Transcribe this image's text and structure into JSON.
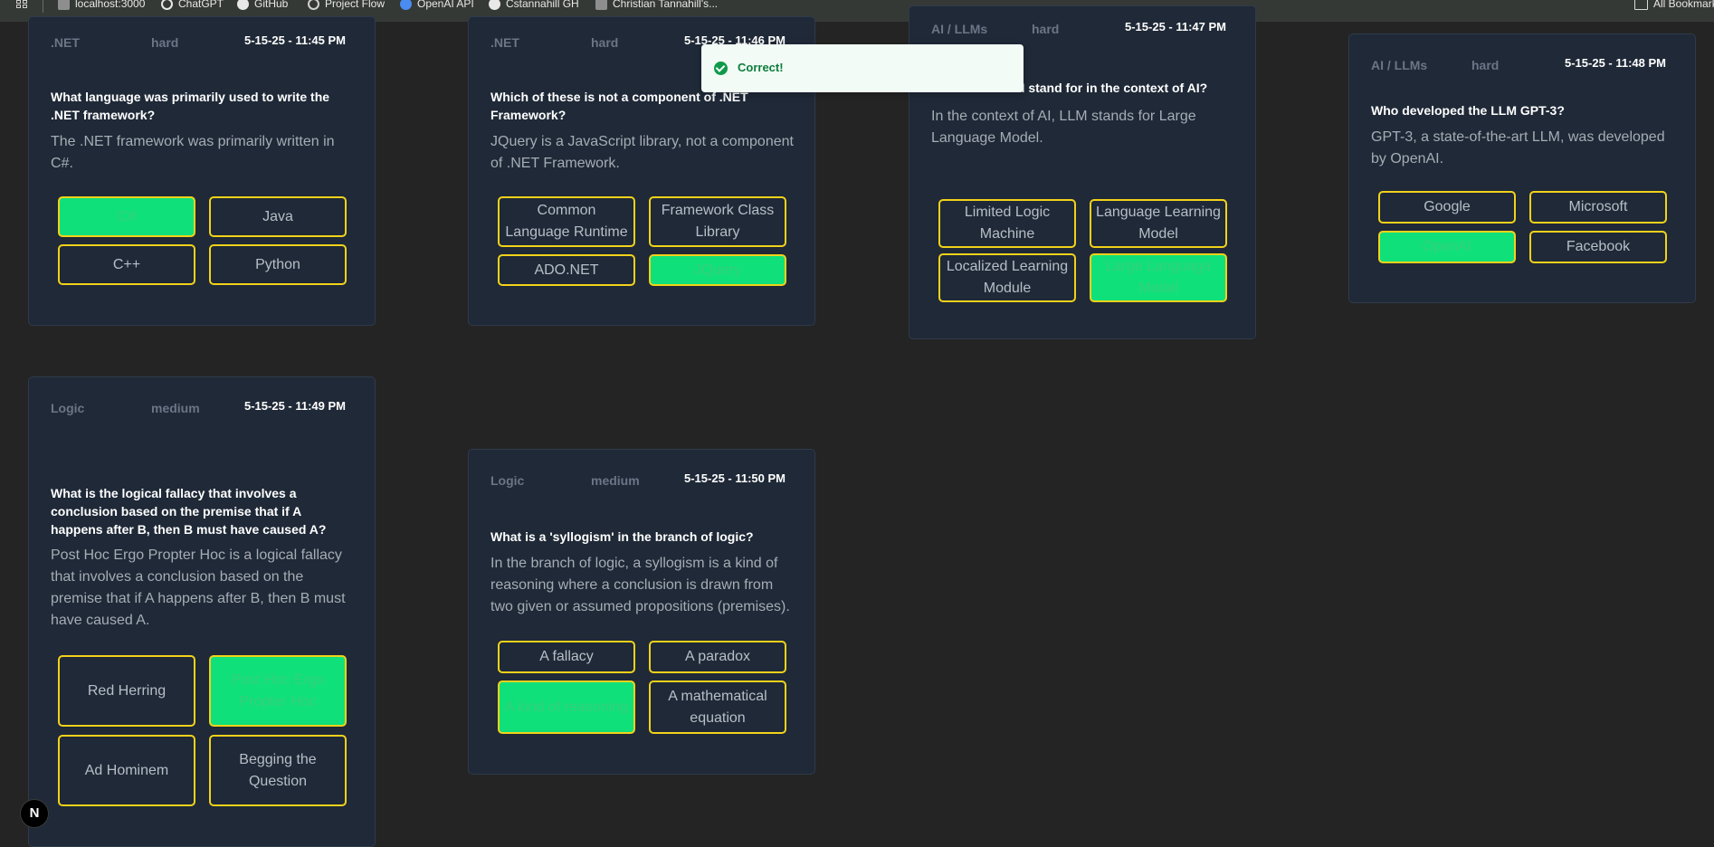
{
  "bookmarks": {
    "items": [
      {
        "label": "localhost:3000",
        "icon": "page-icon"
      },
      {
        "label": "ChatGPT",
        "icon": "chatgpt-icon"
      },
      {
        "label": "GitHub",
        "icon": "github-icon"
      },
      {
        "label": "Project Flow",
        "icon": "globe-icon"
      },
      {
        "label": "OpenAI API",
        "icon": "openai-icon"
      },
      {
        "label": "Cstannahill GH",
        "icon": "github-icon"
      },
      {
        "label": "Christian Tannahill's...",
        "icon": "page-icon"
      }
    ],
    "all_bookmarks": "All Bookmarks"
  },
  "toast": {
    "message": "Correct!"
  },
  "cards": [
    {
      "category": ".NET",
      "difficulty": "hard",
      "date": "5-15-25 - 11:45 PM",
      "question": "What language was primarily used to write the .NET framework?",
      "answer": "The .NET framework was primarily written in C#.",
      "options": [
        "C#",
        "Java",
        "C++",
        "Python"
      ],
      "correct_index": 0
    },
    {
      "category": ".NET",
      "difficulty": "hard",
      "date": "5-15-25 - 11:46 PM",
      "question": "Which of these is not a component of .NET Framework?",
      "answer": "JQuery is a JavaScript library, not a component of .NET Framework.",
      "options": [
        "Common Language Runtime",
        "Framework Class Library",
        "ADO.NET",
        "JQuery"
      ],
      "correct_index": 3
    },
    {
      "category": "AI / LLMs",
      "difficulty": "hard",
      "date": "5-15-25 - 11:47 PM",
      "question": "What does LLM stand for in the context of AI?",
      "answer": "In the context of AI, LLM stands for Large Language Model.",
      "options": [
        "Limited Logic Machine",
        "Language Learning Model",
        "Localized Learning Module",
        "Large Language Model"
      ],
      "correct_index": 3
    },
    {
      "category": "AI / LLMs",
      "difficulty": "hard",
      "date": "5-15-25 - 11:48 PM",
      "question": "Who developed the LLM GPT-3?",
      "answer": "GPT-3, a state-of-the-art LLM, was developed by OpenAI.",
      "options": [
        "Google",
        "Microsoft",
        "OpenAI",
        "Facebook"
      ],
      "correct_index": 2
    },
    {
      "category": "Logic",
      "difficulty": "medium",
      "date": "5-15-25 - 11:49 PM",
      "question": "What is the logical fallacy that involves a conclusion based on the premise that if A happens after B, then B must have caused A?",
      "answer": "Post Hoc Ergo Propter Hoc is a logical fallacy that involves a conclusion based on the premise that if A happens after B, then B must have caused A.",
      "options": [
        "Red Herring",
        "Post Hoc Ergo Propter Hoc",
        "Ad Hominem",
        "Begging the Question"
      ],
      "correct_index": 1
    },
    {
      "category": "Logic",
      "difficulty": "medium",
      "date": "5-15-25 - 11:50 PM",
      "question": "What is a 'syllogism' in the branch of logic?",
      "answer": "In the branch of logic, a syllogism is a kind of reasoning where a conclusion is drawn from two given or assumed propositions (premises).",
      "options": [
        "A fallacy",
        "A paradox",
        "A kind of reasoning",
        "A mathematical equation"
      ],
      "correct_index": 2
    }
  ],
  "dev_badge": {
    "label": "N"
  },
  "colors": {
    "page_bg": "#242424",
    "card_bg": "#1f2937",
    "option_border": "#f2d21a",
    "correct_bg": "#10e07a",
    "toast_bg": "#f2fbf5",
    "toast_text": "#0c7d3c"
  }
}
